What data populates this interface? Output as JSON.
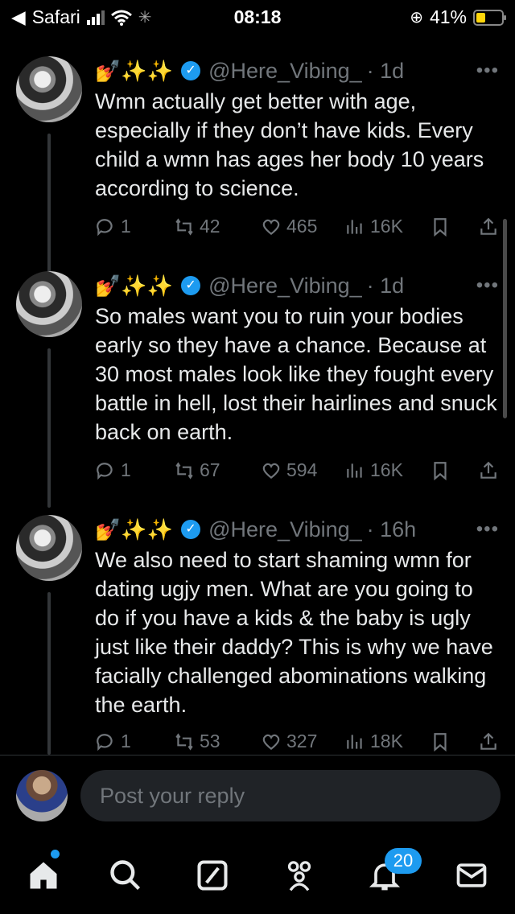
{
  "status_bar": {
    "carrier": "Safari",
    "time": "08:18",
    "battery": "41%",
    "battery_level": 0.41
  },
  "tweets": [
    {
      "emoji": "💅✨✨",
      "handle": "@Here_Vibing_",
      "time": "· 1d",
      "text": "Wmn actually get better with age, especially if they don’t have kids. Every child a wmn has ages her  body 10 years according to science.",
      "replies": "1",
      "retweets": "42",
      "likes": "465",
      "views": "16K"
    },
    {
      "emoji": "💅✨✨",
      "handle": "@Here_Vibing_",
      "time": "· 1d",
      "text": "So males want you to ruin your bodies early so they have a chance. Because at 30 most males look like they fought every battle in hell, lost their hairlines and snuck back on earth.",
      "replies": "1",
      "retweets": "67",
      "likes": "594",
      "views": "16K"
    },
    {
      "emoji": "💅✨✨",
      "handle": "@Here_Vibing_",
      "time": "· 16h",
      "text": "We also need to start shaming wmn for dating ugjy men. What are you going to do if you have a kids & the baby is ugly just like their daddy? This is why we have facially challenged abominations walking the earth.",
      "replies": "1",
      "retweets": "53",
      "likes": "327",
      "views": "18K"
    }
  ],
  "reply": {
    "placeholder": "Post your reply"
  },
  "tabbar": {
    "items": [
      "home-icon",
      "search-icon",
      "grok-icon",
      "communities-icon",
      "notifications-icon",
      "messages-icon"
    ],
    "notification_count": "20"
  },
  "colors": {
    "accent": "#1d9bf0",
    "muted": "#71767b",
    "background": "#000000"
  }
}
